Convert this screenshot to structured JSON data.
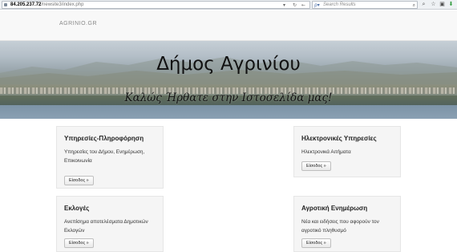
{
  "browser": {
    "url_host": "84.205.237.72",
    "url_path": "/newsite3/index.php",
    "search_placeholder": "Search Results"
  },
  "site": {
    "brand": "AGRINIO.GR",
    "hero_title": "Δήμος Αγρινίου",
    "hero_subtitle": "Καλώς Ήρθατε στην Ιστοσελίδα μας!"
  },
  "cards": [
    {
      "title": "Υπηρεσίες-Πληροφόρηση",
      "text_lines": [
        "Υπηρεσίες του Δήμου, Ενημέρωση,",
        "Επικοινωνία"
      ],
      "button": "Είσοδος »"
    },
    {
      "title": "Ηλεκτρονικές Υπηρεσίες",
      "text_lines": [
        "Ηλεκτρονικά Αιτήματα",
        ""
      ],
      "button": "Είσοδος »"
    },
    {
      "title": "Εκλογές",
      "text_lines": [
        "Ανεπίσημα αποτελέσματα Δημοτικών",
        "Εκλογών"
      ],
      "button": "Είσοδος »"
    },
    {
      "title": "Αγροτική Ενημέρωση",
      "text_lines": [
        "Νέα και ειδήσεις που αφορούν τον",
        "αγροτικό πληθυσμό"
      ],
      "button": "Είσοδος »"
    }
  ],
  "icons": {
    "site_identity": "globe-icon",
    "dropdown": "chevron-down-icon",
    "reload": "reload-icon",
    "back": "back-arrow-icon",
    "search_engine": "search-engine-icon",
    "search_go": "magnifier-icon",
    "bookmark": "star-icon",
    "identity": "lock-icon",
    "download": "download-icon"
  }
}
